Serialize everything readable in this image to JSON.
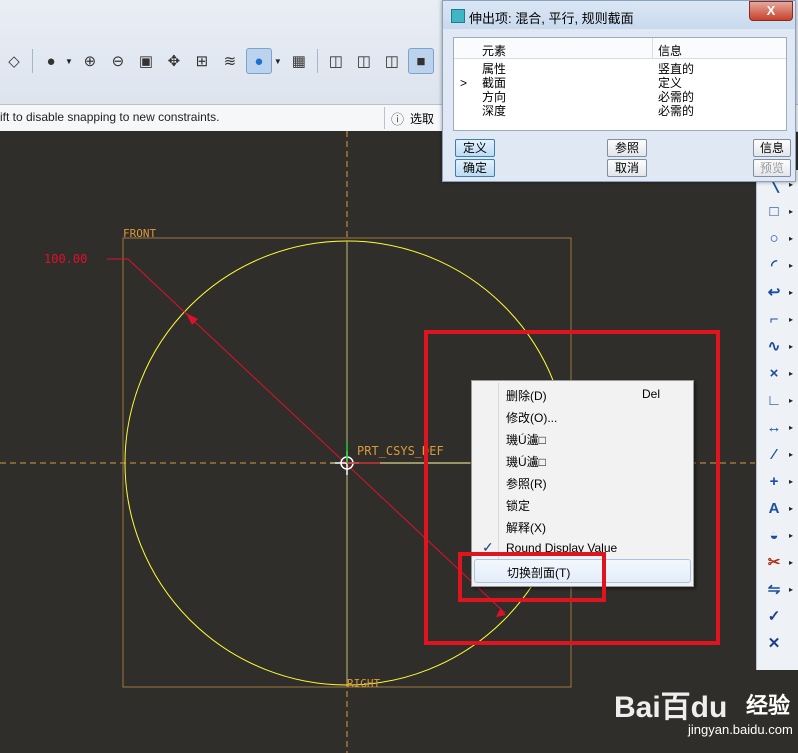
{
  "toolbar": {
    "icons": [
      "view-orient-icon",
      "appearance-sphere-icon",
      "zoom-in-icon",
      "zoom-out-icon",
      "refit-icon",
      "spin-center-icon",
      "annotation-icon",
      "layers-icon",
      "display-style-icon",
      "saved-views-icon",
      "shading-1-icon",
      "shading-2-icon",
      "shading-3-icon",
      "shading-4-icon",
      "datum-plane-icon"
    ]
  },
  "message_bar": {
    "text": "ift to disable snapping to new constraints.",
    "filter_label": "选取"
  },
  "dialog": {
    "title": "伸出项: 混合, 平行, 规则截面",
    "close_glyph": "X",
    "columns": [
      "元素",
      "信息"
    ],
    "rows": [
      {
        "marker": "",
        "element": "属性",
        "info": "竖直的"
      },
      {
        "marker": ">",
        "element": "截面",
        "info": "定义"
      },
      {
        "marker": "",
        "element": "方向",
        "info": "必需的"
      },
      {
        "marker": "",
        "element": "深度",
        "info": "必需的"
      }
    ],
    "buttons": {
      "define": "定义",
      "refs": "参照",
      "info": "信息",
      "ok": "确定",
      "cancel": "取消",
      "preview": "预览"
    }
  },
  "canvas": {
    "background": "#302e2b",
    "sketch_color": "#ffff33",
    "dim_color": "#e0102a",
    "datum_color": "#d99a3a",
    "front_label": "FRONT",
    "right_label": "RIGHT",
    "csys_label": "PRT_CSYS_DEF",
    "dimension_value": "100.00"
  },
  "context_menu": {
    "items": [
      {
        "label": "删除(D)",
        "shortcut": "Del",
        "checked": false,
        "highlight": false
      },
      {
        "label": "修改(O)...",
        "shortcut": "",
        "checked": false,
        "highlight": false
      },
      {
        "label": "璣Ú瀘□",
        "shortcut": "",
        "checked": false,
        "highlight": false
      },
      {
        "label": "璣Ú瀘□",
        "shortcut": "",
        "checked": false,
        "highlight": false
      },
      {
        "label": "参照(R)",
        "shortcut": "",
        "checked": false,
        "highlight": false
      },
      {
        "label": "锁定",
        "shortcut": "",
        "checked": false,
        "highlight": false
      },
      {
        "label": "解释(X)",
        "shortcut": "",
        "checked": false,
        "highlight": false
      },
      {
        "label": "Round Display Value",
        "shortcut": "",
        "checked": true,
        "highlight": false
      },
      {
        "label": "切换剖面(T)",
        "shortcut": "",
        "checked": false,
        "highlight": true
      }
    ],
    "check_glyph": "✓"
  },
  "right_toolbar": {
    "icons": [
      {
        "name": "line-icon",
        "glyph": "╲"
      },
      {
        "name": "rectangle-icon",
        "glyph": "□"
      },
      {
        "name": "circle-icon",
        "glyph": "○"
      },
      {
        "name": "arc-icon",
        "glyph": "◜"
      },
      {
        "name": "fillet-icon",
        "glyph": "↩"
      },
      {
        "name": "chamfer-icon",
        "glyph": "⌐"
      },
      {
        "name": "spline-icon",
        "glyph": "∿"
      },
      {
        "name": "point-icon",
        "glyph": "×"
      },
      {
        "name": "coordinate-system-icon",
        "glyph": "∟"
      },
      {
        "name": "dimension-icon",
        "glyph": "↔"
      },
      {
        "name": "modify-icon",
        "glyph": "⁄"
      },
      {
        "name": "constraint-icon",
        "glyph": "+"
      },
      {
        "name": "text-icon",
        "glyph": "A"
      },
      {
        "name": "palette-icon",
        "glyph": "◒"
      },
      {
        "name": "trim-icon",
        "glyph": "✂"
      },
      {
        "name": "mirror-icon",
        "glyph": "⇋"
      },
      {
        "name": "accept-icon",
        "glyph": "✓"
      },
      {
        "name": "cancel-icon",
        "glyph": "✕"
      }
    ]
  },
  "watermark": {
    "logo": "Bai百du",
    "jingyan": "经验",
    "url": "jingyan.baidu.com"
  }
}
